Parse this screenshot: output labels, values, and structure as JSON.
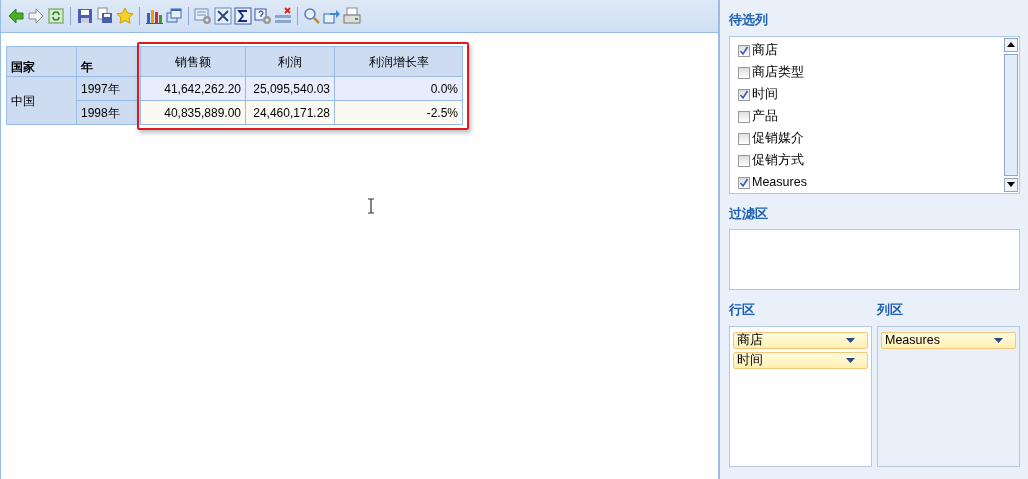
{
  "table": {
    "columns": [
      "国家",
      "年",
      "销售额",
      "利润",
      "利润增长率"
    ],
    "groups": [
      {
        "country": "中国",
        "rows": [
          {
            "year": "1997年",
            "values": [
              "41,642,262.20",
              "25,095,540.03",
              "0.0%"
            ]
          },
          {
            "year": "1998年",
            "values": [
              "40,835,889.00",
              "24,460,171.28",
              "-2.5%"
            ]
          }
        ]
      }
    ]
  },
  "candidates": {
    "title": "待选列",
    "items": [
      {
        "label": "商店",
        "checked": true
      },
      {
        "label": "商店类型",
        "checked": false
      },
      {
        "label": "时间",
        "checked": true
      },
      {
        "label": "产品",
        "checked": false
      },
      {
        "label": "促销媒介",
        "checked": false
      },
      {
        "label": "促销方式",
        "checked": false
      },
      {
        "label": "Measures",
        "checked": true
      }
    ]
  },
  "filter_area": {
    "title": "过滤区"
  },
  "row_area": {
    "title": "行区",
    "fields": [
      "商店",
      "时间"
    ]
  },
  "column_area": {
    "title": "列区",
    "fields": [
      "Measures"
    ]
  }
}
